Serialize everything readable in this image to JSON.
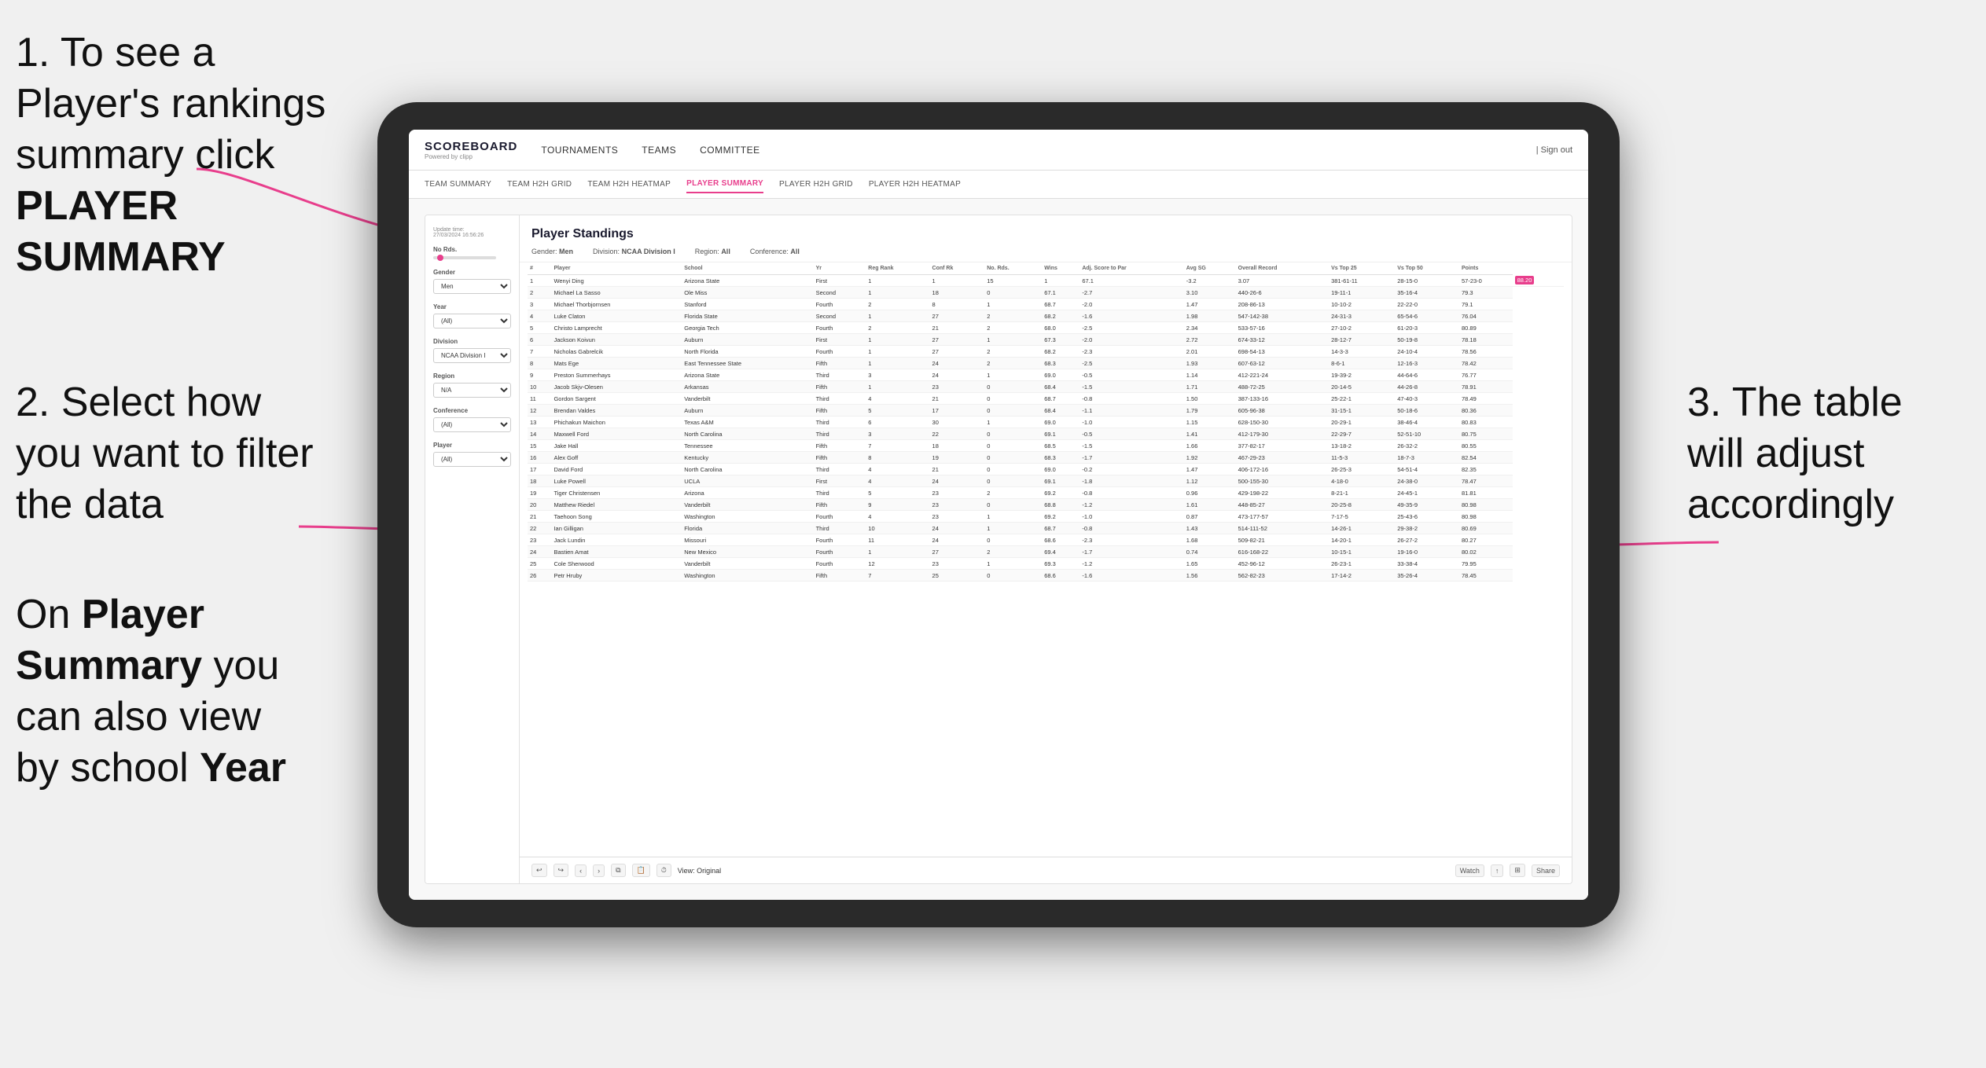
{
  "instructions": {
    "step1": "1. To see a Player's rankings summary click ",
    "step1_bold": "PLAYER SUMMARY",
    "step2_title": "2. Select how you want to filter the data",
    "step3": "3. The table will adjust accordingly",
    "on_player_summary": "On ",
    "player_summary_bold": "Player Summary",
    "on_text": " you can also view by school ",
    "year_bold": "Year"
  },
  "nav": {
    "logo": "SCOREBOARD",
    "logo_sub": "Powered by clipp",
    "items": [
      "TOURNAMENTS",
      "TEAMS",
      "COMMITTEE"
    ],
    "right": [
      "| Sign out"
    ]
  },
  "subnav": {
    "items": [
      "TEAM SUMMARY",
      "TEAM H2H GRID",
      "TEAM H2H HEATMAP",
      "PLAYER SUMMARY",
      "PLAYER H2H GRID",
      "PLAYER H2H HEATMAP"
    ],
    "active": "PLAYER SUMMARY"
  },
  "filters": {
    "update_time_label": "Update time:",
    "update_time": "27/03/2024 16:56:26",
    "no_rds_label": "No Rds.",
    "gender_label": "Gender",
    "gender_value": "Men",
    "year_label": "Year",
    "year_value": "(All)",
    "division_label": "Division",
    "division_value": "NCAA Division I",
    "region_label": "Region",
    "region_value": "N/A",
    "conference_label": "Conference",
    "conference_value": "(All)",
    "player_label": "Player",
    "player_value": "(All)"
  },
  "standings": {
    "title": "Player Standings",
    "gender_label": "Gender:",
    "gender_val": "Men",
    "division_label": "Division:",
    "division_val": "NCAA Division I",
    "region_label": "Region:",
    "region_val": "All",
    "conference_label": "Conference:",
    "conference_val": "All"
  },
  "table": {
    "headers": [
      "#",
      "Player",
      "School",
      "Yr",
      "Reg Rank",
      "Conf Rk",
      "No. Rds.",
      "Wins",
      "Adj. Score to Par",
      "Avg SG",
      "Overall Record",
      "Vs Top 25",
      "Vs Top 50",
      "Points"
    ],
    "rows": [
      [
        "1",
        "Wenyi Ding",
        "Arizona State",
        "First",
        "1",
        "1",
        "15",
        "1",
        "67.1",
        "-3.2",
        "3.07",
        "381-61-11",
        "28-15-0",
        "57-23-0",
        "88.20"
      ],
      [
        "2",
        "Michael La Sasso",
        "Ole Miss",
        "Second",
        "1",
        "18",
        "0",
        "67.1",
        "-2.7",
        "3.10",
        "440-26-6",
        "19-11-1",
        "35-16-4",
        "79.3"
      ],
      [
        "3",
        "Michael Thorbjornsen",
        "Stanford",
        "Fourth",
        "2",
        "8",
        "1",
        "68.7",
        "-2.0",
        "1.47",
        "208-86-13",
        "10-10-2",
        "22-22-0",
        "79.1"
      ],
      [
        "4",
        "Luke Claton",
        "Florida State",
        "Second",
        "1",
        "27",
        "2",
        "68.2",
        "-1.6",
        "1.98",
        "547-142-38",
        "24-31-3",
        "65-54-6",
        "76.04"
      ],
      [
        "5",
        "Christo Lamprecht",
        "Georgia Tech",
        "Fourth",
        "2",
        "21",
        "2",
        "68.0",
        "-2.5",
        "2.34",
        "533-57-16",
        "27-10-2",
        "61-20-3",
        "80.89"
      ],
      [
        "6",
        "Jackson Koivun",
        "Auburn",
        "First",
        "1",
        "27",
        "1",
        "67.3",
        "-2.0",
        "2.72",
        "674-33-12",
        "28-12-7",
        "50-19-8",
        "78.18"
      ],
      [
        "7",
        "Nicholas Gabrelcik",
        "North Florida",
        "Fourth",
        "1",
        "27",
        "2",
        "68.2",
        "-2.3",
        "2.01",
        "698-54-13",
        "14-3-3",
        "24-10-4",
        "78.56"
      ],
      [
        "8",
        "Mats Ege",
        "East Tennessee State",
        "Fifth",
        "1",
        "24",
        "2",
        "68.3",
        "-2.5",
        "1.93",
        "607-63-12",
        "8-6-1",
        "12-16-3",
        "78.42"
      ],
      [
        "9",
        "Preston Summerhays",
        "Arizona State",
        "Third",
        "3",
        "24",
        "1",
        "69.0",
        "-0.5",
        "1.14",
        "412-221-24",
        "19-39-2",
        "44-64-6",
        "76.77"
      ],
      [
        "10",
        "Jacob Skjv-Olesen",
        "Arkansas",
        "Fifth",
        "1",
        "23",
        "0",
        "68.4",
        "-1.5",
        "1.71",
        "488-72-25",
        "20-14-5",
        "44-26-8",
        "78.91"
      ],
      [
        "11",
        "Gordon Sargent",
        "Vanderbilt",
        "Third",
        "4",
        "21",
        "0",
        "68.7",
        "-0.8",
        "1.50",
        "387-133-16",
        "25-22-1",
        "47-40-3",
        "78.49"
      ],
      [
        "12",
        "Brendan Valdes",
        "Auburn",
        "Fifth",
        "5",
        "17",
        "0",
        "68.4",
        "-1.1",
        "1.79",
        "605-96-38",
        "31-15-1",
        "50-18-6",
        "80.36"
      ],
      [
        "13",
        "Phichakun Maichon",
        "Texas A&M",
        "Third",
        "6",
        "30",
        "1",
        "69.0",
        "-1.0",
        "1.15",
        "628-150-30",
        "20-29-1",
        "38-46-4",
        "80.83"
      ],
      [
        "14",
        "Maxwell Ford",
        "North Carolina",
        "Third",
        "3",
        "22",
        "0",
        "69.1",
        "-0.5",
        "1.41",
        "412-179-30",
        "22-29-7",
        "52-51-10",
        "80.75"
      ],
      [
        "15",
        "Jake Hall",
        "Tennessee",
        "Fifth",
        "7",
        "18",
        "0",
        "68.5",
        "-1.5",
        "1.66",
        "377-82-17",
        "13-18-2",
        "26-32-2",
        "80.55"
      ],
      [
        "16",
        "Alex Goff",
        "Kentucky",
        "Fifth",
        "8",
        "19",
        "0",
        "68.3",
        "-1.7",
        "1.92",
        "467-29-23",
        "11-5-3",
        "18-7-3",
        "82.54"
      ],
      [
        "17",
        "David Ford",
        "North Carolina",
        "Third",
        "4",
        "21",
        "0",
        "69.0",
        "-0.2",
        "1.47",
        "406-172-16",
        "26-25-3",
        "54-51-4",
        "82.35"
      ],
      [
        "18",
        "Luke Powell",
        "UCLA",
        "First",
        "4",
        "24",
        "0",
        "69.1",
        "-1.8",
        "1.12",
        "500-155-30",
        "4-18-0",
        "24-38-0",
        "78.47"
      ],
      [
        "19",
        "Tiger Christensen",
        "Arizona",
        "Third",
        "5",
        "23",
        "2",
        "69.2",
        "-0.8",
        "0.96",
        "429-198-22",
        "8-21-1",
        "24-45-1",
        "81.81"
      ],
      [
        "20",
        "Matthew Riedel",
        "Vanderbilt",
        "Fifth",
        "9",
        "23",
        "0",
        "68.8",
        "-1.2",
        "1.61",
        "448-85-27",
        "20-25-8",
        "49-35-9",
        "80.98"
      ],
      [
        "21",
        "Taehoon Song",
        "Washington",
        "Fourth",
        "4",
        "23",
        "1",
        "69.2",
        "-1.0",
        "0.87",
        "473-177-57",
        "7-17-5",
        "25-43-6",
        "80.98"
      ],
      [
        "22",
        "Ian Gilligan",
        "Florida",
        "Third",
        "10",
        "24",
        "1",
        "68.7",
        "-0.8",
        "1.43",
        "514-111-52",
        "14-26-1",
        "29-38-2",
        "80.69"
      ],
      [
        "23",
        "Jack Lundin",
        "Missouri",
        "Fourth",
        "11",
        "24",
        "0",
        "68.6",
        "-2.3",
        "1.68",
        "509-82-21",
        "14-20-1",
        "26-27-2",
        "80.27"
      ],
      [
        "24",
        "Bastien Amat",
        "New Mexico",
        "Fourth",
        "1",
        "27",
        "2",
        "69.4",
        "-1.7",
        "0.74",
        "616-168-22",
        "10-15-1",
        "19-16-0",
        "80.02"
      ],
      [
        "25",
        "Cole Sherwood",
        "Vanderbilt",
        "Fourth",
        "12",
        "23",
        "1",
        "69.3",
        "-1.2",
        "1.65",
        "452-96-12",
        "26-23-1",
        "33-38-4",
        "79.95"
      ],
      [
        "26",
        "Petr Hruby",
        "Washington",
        "Fifth",
        "7",
        "25",
        "0",
        "68.6",
        "-1.6",
        "1.56",
        "562-82-23",
        "17-14-2",
        "35-26-4",
        "78.45"
      ]
    ]
  },
  "toolbar": {
    "view_label": "View: Original",
    "watch_label": "Watch",
    "share_label": "Share"
  }
}
